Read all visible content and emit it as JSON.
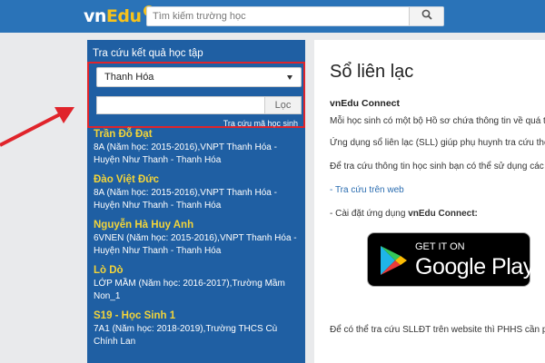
{
  "header": {
    "logo_main": "vn",
    "logo_accent": "Edu",
    "search_placeholder": "Tìm kiếm trường học",
    "search_icon": "search-icon"
  },
  "left_panel": {
    "title": "Tra cứu kết quả học tập",
    "province_select": "Thanh Hóa",
    "filter_button": "Lọc",
    "student_code_link": "Tra cứu mã học sinh",
    "results": [
      {
        "name": "Trần Đỗ Đạt",
        "detail": "8A (Năm học: 2015-2016),VNPT Thanh Hóa - Huyện Như Thanh - Thanh Hóa"
      },
      {
        "name": "Đào Việt Đức",
        "detail": "8A (Năm học: 2015-2016),VNPT Thanh Hóa - Huyện Như Thanh - Thanh Hóa"
      },
      {
        "name": "Nguyễn Hà Huy Anh",
        "detail": "6VNEN (Năm học: 2015-2016),VNPT Thanh Hóa - Huyện Như Thanh - Thanh Hóa"
      },
      {
        "name": "Lò Dò",
        "detail": "LỚP MẦM (Năm học: 2016-2017),Trường Mầm Non_1"
      },
      {
        "name": "S19 - Học Sinh 1",
        "detail": "7A1 (Năm học: 2018-2019),Trường THCS Cù Chính Lan"
      }
    ]
  },
  "right_card": {
    "title": "Sổ liên lạc",
    "subtitle": "vnEdu Connect",
    "para1": "Mỗi học sinh có một bộ Hồ sơ chứa thông tin về quá trình",
    "para2": "Ứng dụng sổ liên lạc (SLL) giúp phụ huynh tra cứu thông",
    "para3": "Để tra cứu thông tin học sinh bạn có thể sử dụng các cô",
    "web_link_prefix": "- ",
    "web_link": "Tra cứu trên web",
    "app_prefix": "- Cài đặt ứng dụng ",
    "app_name": "vnEdu Connect:",
    "badge_top": "GET IT ON",
    "badge_main": "Google Play",
    "footer": "Để có thể tra cứu SLLĐT trên website thì PHHS cần phả"
  },
  "colors": {
    "header": "#2a73b8",
    "panel": "#1f5fa3",
    "student_name": "#f2d43a",
    "highlight_box": "#e0242b",
    "arrow": "#e0242b"
  }
}
